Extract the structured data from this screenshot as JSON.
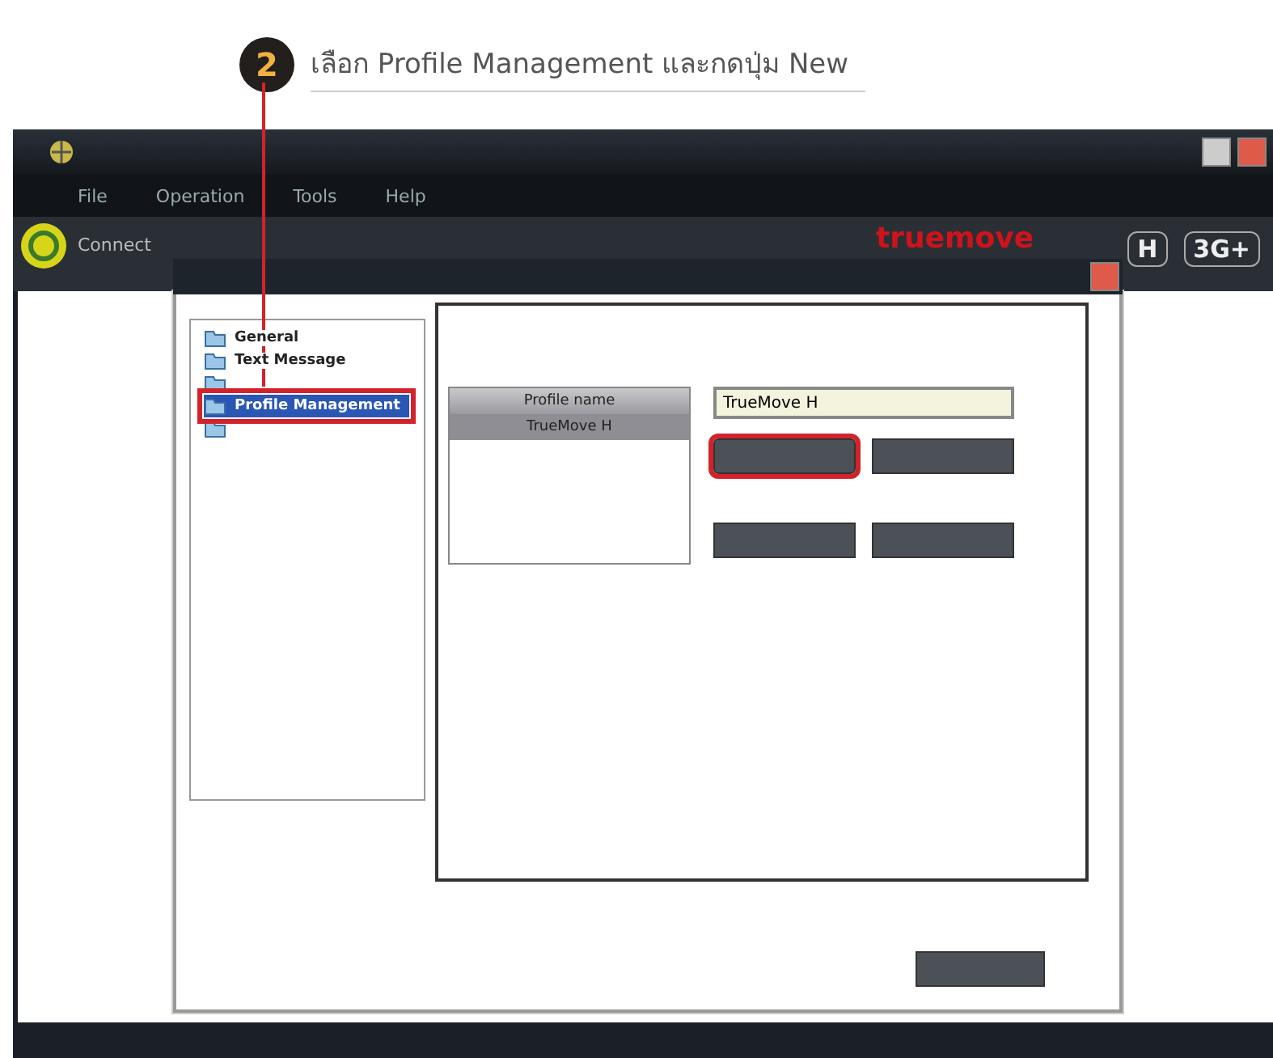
{
  "callout": {
    "number": "2",
    "text": "เลือก Profile Management และกดปุ่ม New"
  },
  "menu": [
    "File",
    "Operation",
    "Tools",
    "Help"
  ],
  "toolbar": {
    "connect_label": "Connect",
    "logo": "truemove",
    "badges": [
      "H",
      "3G+"
    ]
  },
  "dialog": {
    "tree": [
      {
        "label": "General",
        "selected": false
      },
      {
        "label": "Text Message",
        "selected": false
      },
      {
        "selected": false
      },
      {
        "label": "Profile Management",
        "selected": true
      },
      {
        "selected": false
      }
    ],
    "profile_list": {
      "header": "Profile name",
      "rows": [
        {
          "label": "TrueMove H",
          "selected": true
        }
      ]
    },
    "name_field": {
      "value": "TrueMove H"
    },
    "buttons": [
      {
        "highlighted": true
      },
      {
        "highlighted": false
      },
      {
        "highlighted": false
      },
      {
        "highlighted": false
      }
    ]
  }
}
